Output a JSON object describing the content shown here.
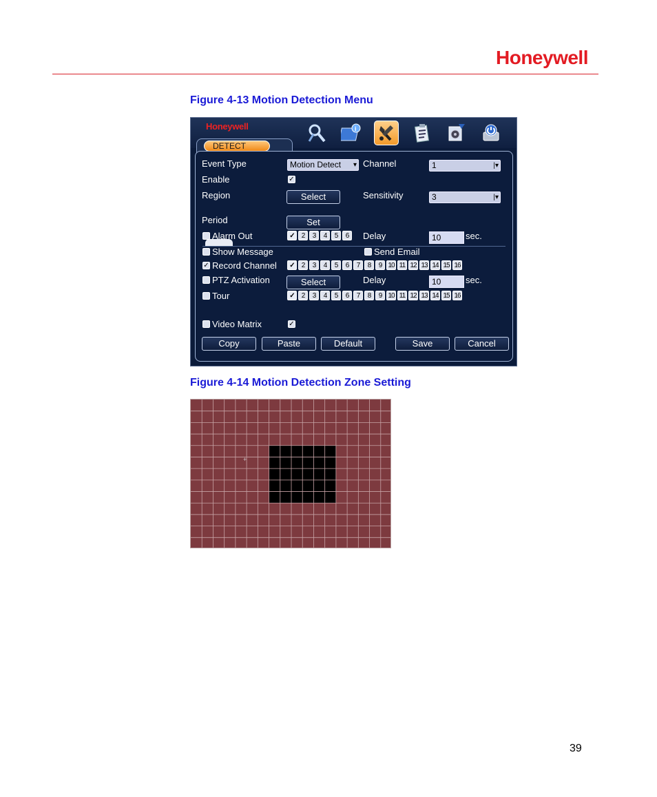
{
  "header": {
    "brand": "Honeywell"
  },
  "captions": {
    "fig_13": "Figure 4-13 Motion Detection Menu",
    "fig_14": "Figure 4-14 Motion Detection Zone Setting"
  },
  "page_number": "39",
  "dvr": {
    "logo": "Honeywell",
    "tab": "DETECT",
    "toolbar_icons": [
      "search-icon",
      "network-icon",
      "tools-icon",
      "clipboard-icon",
      "backup-icon",
      "shutdown-icon"
    ],
    "active_icon": "tools-icon",
    "event_type": {
      "label": "Event Type",
      "value": "Motion Detect"
    },
    "channel": {
      "label": "Channel",
      "value": "1"
    },
    "enable": {
      "label": "Enable",
      "checked": true
    },
    "region": {
      "label": "Region",
      "button": "Select"
    },
    "sensitivity": {
      "label": "Sensitivity",
      "value": "3"
    },
    "period": {
      "label": "Period",
      "button": "Set"
    },
    "alarm_out": {
      "label": "Alarm Out",
      "checked": false,
      "channels": [
        "1",
        "2",
        "3",
        "4",
        "5",
        "6"
      ],
      "checked_channels": [
        "1"
      ]
    },
    "delay1": {
      "label": "Delay",
      "value": "10",
      "unit": "sec."
    },
    "show_message": {
      "label": "Show Message",
      "checked": false
    },
    "send_email": {
      "label": "Send Email",
      "checked": false
    },
    "record_channel": {
      "label": "Record Channel",
      "checked": true,
      "channels": [
        "1",
        "2",
        "3",
        "4",
        "5",
        "6",
        "7",
        "8",
        "9",
        "10",
        "11",
        "12",
        "13",
        "14",
        "15",
        "16"
      ],
      "checked_channels": [
        "1"
      ]
    },
    "ptz_activation": {
      "label": "PTZ Activation",
      "checked": false,
      "button": "Select"
    },
    "delay2": {
      "label": "Delay",
      "value": "10",
      "unit": "sec."
    },
    "tour": {
      "label": "Tour",
      "checked": false,
      "channels": [
        "1",
        "2",
        "3",
        "4",
        "5",
        "6",
        "7",
        "8",
        "9",
        "10",
        "11",
        "12",
        "13",
        "14",
        "15",
        "16"
      ],
      "checked_channels": [
        "1"
      ]
    },
    "video_matrix": {
      "label": "Video Matrix",
      "checked": false,
      "enabled": true
    },
    "buttons": {
      "copy": "Copy",
      "paste": "Paste",
      "default": "Default",
      "save": "Save",
      "cancel": "Cancel"
    }
  },
  "zone": {
    "columns": 18,
    "rows": 13,
    "zone_color": "#7d3a3f",
    "selected_color": "#000000",
    "unselected_rect": {
      "col_start": 7,
      "col_end": 13,
      "row_start": 4,
      "row_end": 9
    }
  }
}
